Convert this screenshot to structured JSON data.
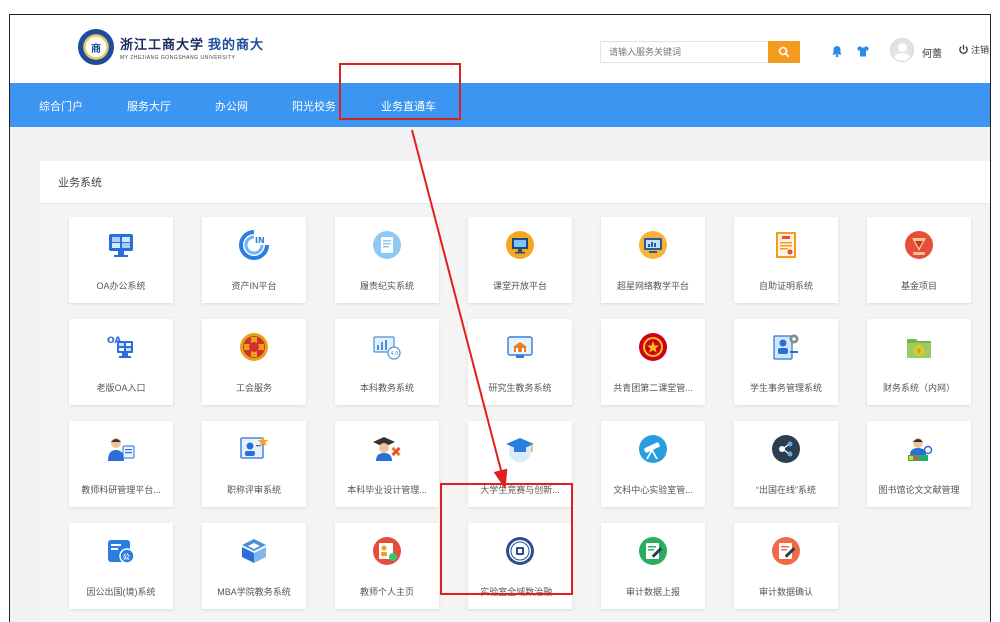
{
  "header": {
    "logo_cn": "浙江工商大学",
    "logo_sub": "我的商大",
    "logo_en": "MY ZHEJIANG GONGSHANG UNIVERSITY",
    "search_placeholder": "请输入服务关键词",
    "username": "何蕾",
    "logout_label": "注销"
  },
  "nav": {
    "items": [
      {
        "label": "综合门户"
      },
      {
        "label": "服务大厅"
      },
      {
        "label": "办公网"
      },
      {
        "label": "阳光校务"
      },
      {
        "label": "业务直通车"
      }
    ],
    "active_index": 4
  },
  "panel": {
    "title": "业务系统",
    "tiles": [
      {
        "label": "OA办公系统",
        "icon": "monitor-icon"
      },
      {
        "label": "资产IN平台",
        "icon": "in-platform-icon"
      },
      {
        "label": "履责纪实系统",
        "icon": "document-icon"
      },
      {
        "label": "课堂开放平台",
        "icon": "classroom-screen-icon"
      },
      {
        "label": "超星网络教学平台",
        "icon": "online-teaching-icon"
      },
      {
        "label": "自助证明系统",
        "icon": "certificate-icon"
      },
      {
        "label": "基金项目",
        "icon": "fund-project-icon"
      },
      {
        "label": "老版OA入口",
        "icon": "old-oa-icon"
      },
      {
        "label": "工会服务",
        "icon": "union-badge-icon"
      },
      {
        "label": "本科教务系统",
        "icon": "academic-chart-icon"
      },
      {
        "label": "研究生教务系统",
        "icon": "graduate-affairs-icon"
      },
      {
        "label": "共青团第二课堂管...",
        "icon": "youth-league-icon"
      },
      {
        "label": "学生事务管理系统",
        "icon": "student-affairs-icon"
      },
      {
        "label": "财务系统（内网）",
        "icon": "finance-folder-icon"
      },
      {
        "label": "教师科研管理平台...",
        "icon": "research-management-icon"
      },
      {
        "label": "职称评审系统",
        "icon": "title-review-icon"
      },
      {
        "label": "本科毕业设计管理...",
        "icon": "graduation-design-icon"
      },
      {
        "label": "大学生竞赛与创新...",
        "icon": "competition-cap-icon"
      },
      {
        "label": "文科中心实验室管...",
        "icon": "lab-telescope-icon"
      },
      {
        "label": "“出国在线”系统",
        "icon": "abroad-online-icon"
      },
      {
        "label": "图书馆论文文献管理",
        "icon": "library-paper-icon"
      },
      {
        "label": "因公出国(境)系统",
        "icon": "official-abroad-icon"
      },
      {
        "label": "MBA学院教务系统",
        "icon": "mba-logo-icon"
      },
      {
        "label": "教师个人主页",
        "icon": "teacher-homepage-icon"
      },
      {
        "label": "实验室全域数治融...",
        "icon": "lab-seal-icon"
      },
      {
        "label": "审计数据上报",
        "icon": "audit-report-icon"
      },
      {
        "label": "审计数据确认",
        "icon": "audit-confirm-icon"
      }
    ]
  },
  "colors": {
    "nav_bg": "#3c95f0",
    "search_btn": "#f39c1f",
    "highlight": "#e02020"
  }
}
